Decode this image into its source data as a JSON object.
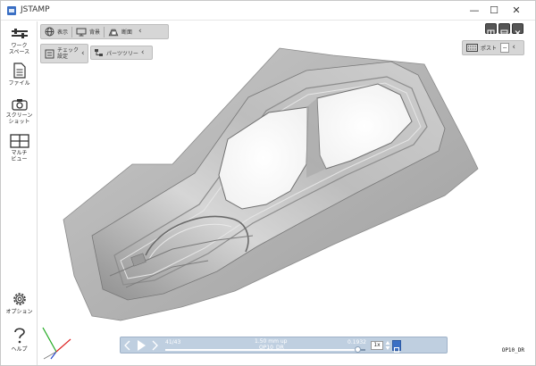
{
  "window": {
    "title": "JSTAMP",
    "minimize": "—",
    "maximize": "☐",
    "close": "✕"
  },
  "sidebar": {
    "items": [
      {
        "label": "ワーク\nスペース",
        "icon": "workspace-icon"
      },
      {
        "label": "ファイル",
        "icon": "file-icon"
      },
      {
        "label": "スクリーン\nショット",
        "icon": "camera-icon"
      },
      {
        "label": "マルチ\nビュー",
        "icon": "multiview-icon"
      },
      {
        "label": "オプション",
        "icon": "gear-icon"
      },
      {
        "label": "ヘルプ",
        "icon": "help-icon"
      }
    ]
  },
  "toolbar": {
    "display_label": "表示",
    "background_label": "背景",
    "section_label": "断面",
    "check_label": "チェック\n設定",
    "part_tree_label": "パーツツリー",
    "post_label": "ポスト",
    "post_value": "--"
  },
  "playback": {
    "frame_counter": "41/43",
    "stroke_text": "1.50 mm up",
    "operation": "OP10_DR",
    "time_value": "0.1932",
    "speed": "1x",
    "progress_fraction": 0.96
  },
  "viewport": {
    "operation_label": "OP10_DR"
  },
  "colors": {
    "accent": "#3a6fc4",
    "playbar": "#bfcfe0"
  }
}
